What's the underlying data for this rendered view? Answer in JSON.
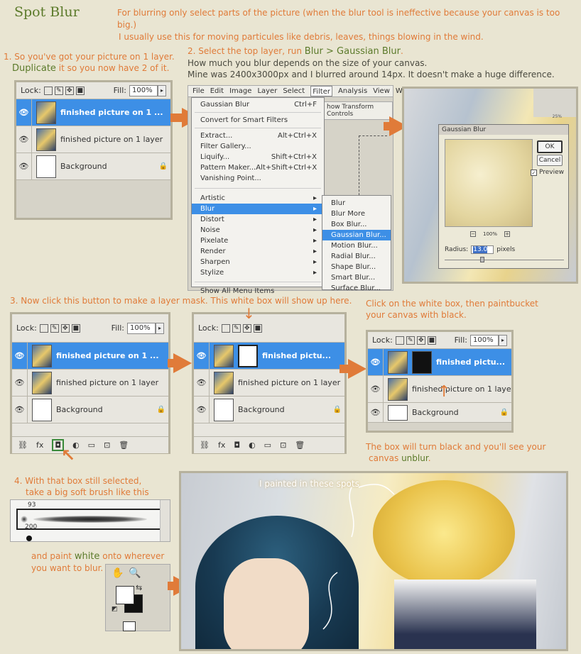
{
  "title": "Spot Blur",
  "intro": [
    "For blurring only select parts of the picture (when the blur tool is ineffective because your canvas is too big.)",
    "I usually use this for moving particules like debris, leaves, things blowing in the wind."
  ],
  "step1": {
    "line1": "1. So you've got your picture on 1 layer.",
    "dup": "Duplicate",
    "line2": " it so you now have 2 of it."
  },
  "step2": {
    "line1a": "2. Select the top layer, run ",
    "blur": "Blur > Gaussian Blur",
    "line1b": ".",
    "line2": "How much you blur depends on the size of your canvas.",
    "line3": "Mine was 2400x3000px and I blurred around 14px. It doesn't make a huge difference."
  },
  "step3": {
    "line1": "3. Now click this button to make a layer mask. This white box will show up here."
  },
  "step3b": {
    "line1": "Click on the white box, then paintbucket",
    "line2": "your canvas with black."
  },
  "step3c": {
    "line1": "The box will turn black and you'll see your",
    "line2": "canvas ",
    "unblur": "unblur",
    "line3": "."
  },
  "step4": {
    "line1": "4. With that box still selected,",
    "line2": "take a big soft brush like this",
    "line3a": "and paint ",
    "white": "white",
    "line3b": " onto wherever",
    "line4": "you want to blur."
  },
  "painted": "I painted in these spots",
  "layers_panel": {
    "lock": "Lock:",
    "fill": "Fill:",
    "fill_value": "100%",
    "layer_copy": "finished picture on 1 ...",
    "layer_copy2": "finished pictu...",
    "layer_orig": "finished picture on 1 layer",
    "background": "Background"
  },
  "menubar": [
    "File",
    "Edit",
    "Image",
    "Layer",
    "Select",
    "Filter",
    "Analysis",
    "View",
    "Win"
  ],
  "filter_menu": {
    "top": [
      {
        "label": "Gaussian Blur",
        "sc": "Ctrl+F"
      }
    ],
    "convert": "Convert for Smart Filters",
    "group1": [
      {
        "label": "Extract...",
        "sc": "Alt+Ctrl+X"
      },
      {
        "label": "Filter Gallery...",
        "sc": ""
      },
      {
        "label": "Liquify...",
        "sc": "Shift+Ctrl+X"
      },
      {
        "label": "Pattern Maker...",
        "sc": "Alt+Shift+Ctrl+X"
      },
      {
        "label": "Vanishing Point...",
        "sc": ""
      }
    ],
    "group2": [
      "Artistic",
      "Blur",
      "Distort",
      "Noise",
      "Pixelate",
      "Render",
      "Sharpen",
      "Stylize"
    ],
    "bottom": "Show All Menu Items",
    "toolbar_hint": "how Transform Controls"
  },
  "blur_submenu": [
    "Blur",
    "Blur More",
    "Box Blur...",
    "Gaussian Blur...",
    "Motion Blur...",
    "Radial Blur...",
    "Shape Blur...",
    "Smart Blur...",
    "Surface Blur..."
  ],
  "gaussian_dialog": {
    "title": "Gaussian Blur",
    "ok": "OK",
    "cancel": "Cancel",
    "preview": "Preview",
    "zoom": "100%",
    "radius_label": "Radius:",
    "radius_value": "13.0",
    "units": "pixels"
  },
  "side_panel": {
    "zoom": "25%"
  },
  "brush_panel": {
    "size1": "93",
    "size2": "200"
  },
  "colors": {
    "accent": "#e07b39",
    "selected": "#3d8fe6",
    "bg": "#e9e5d2"
  }
}
